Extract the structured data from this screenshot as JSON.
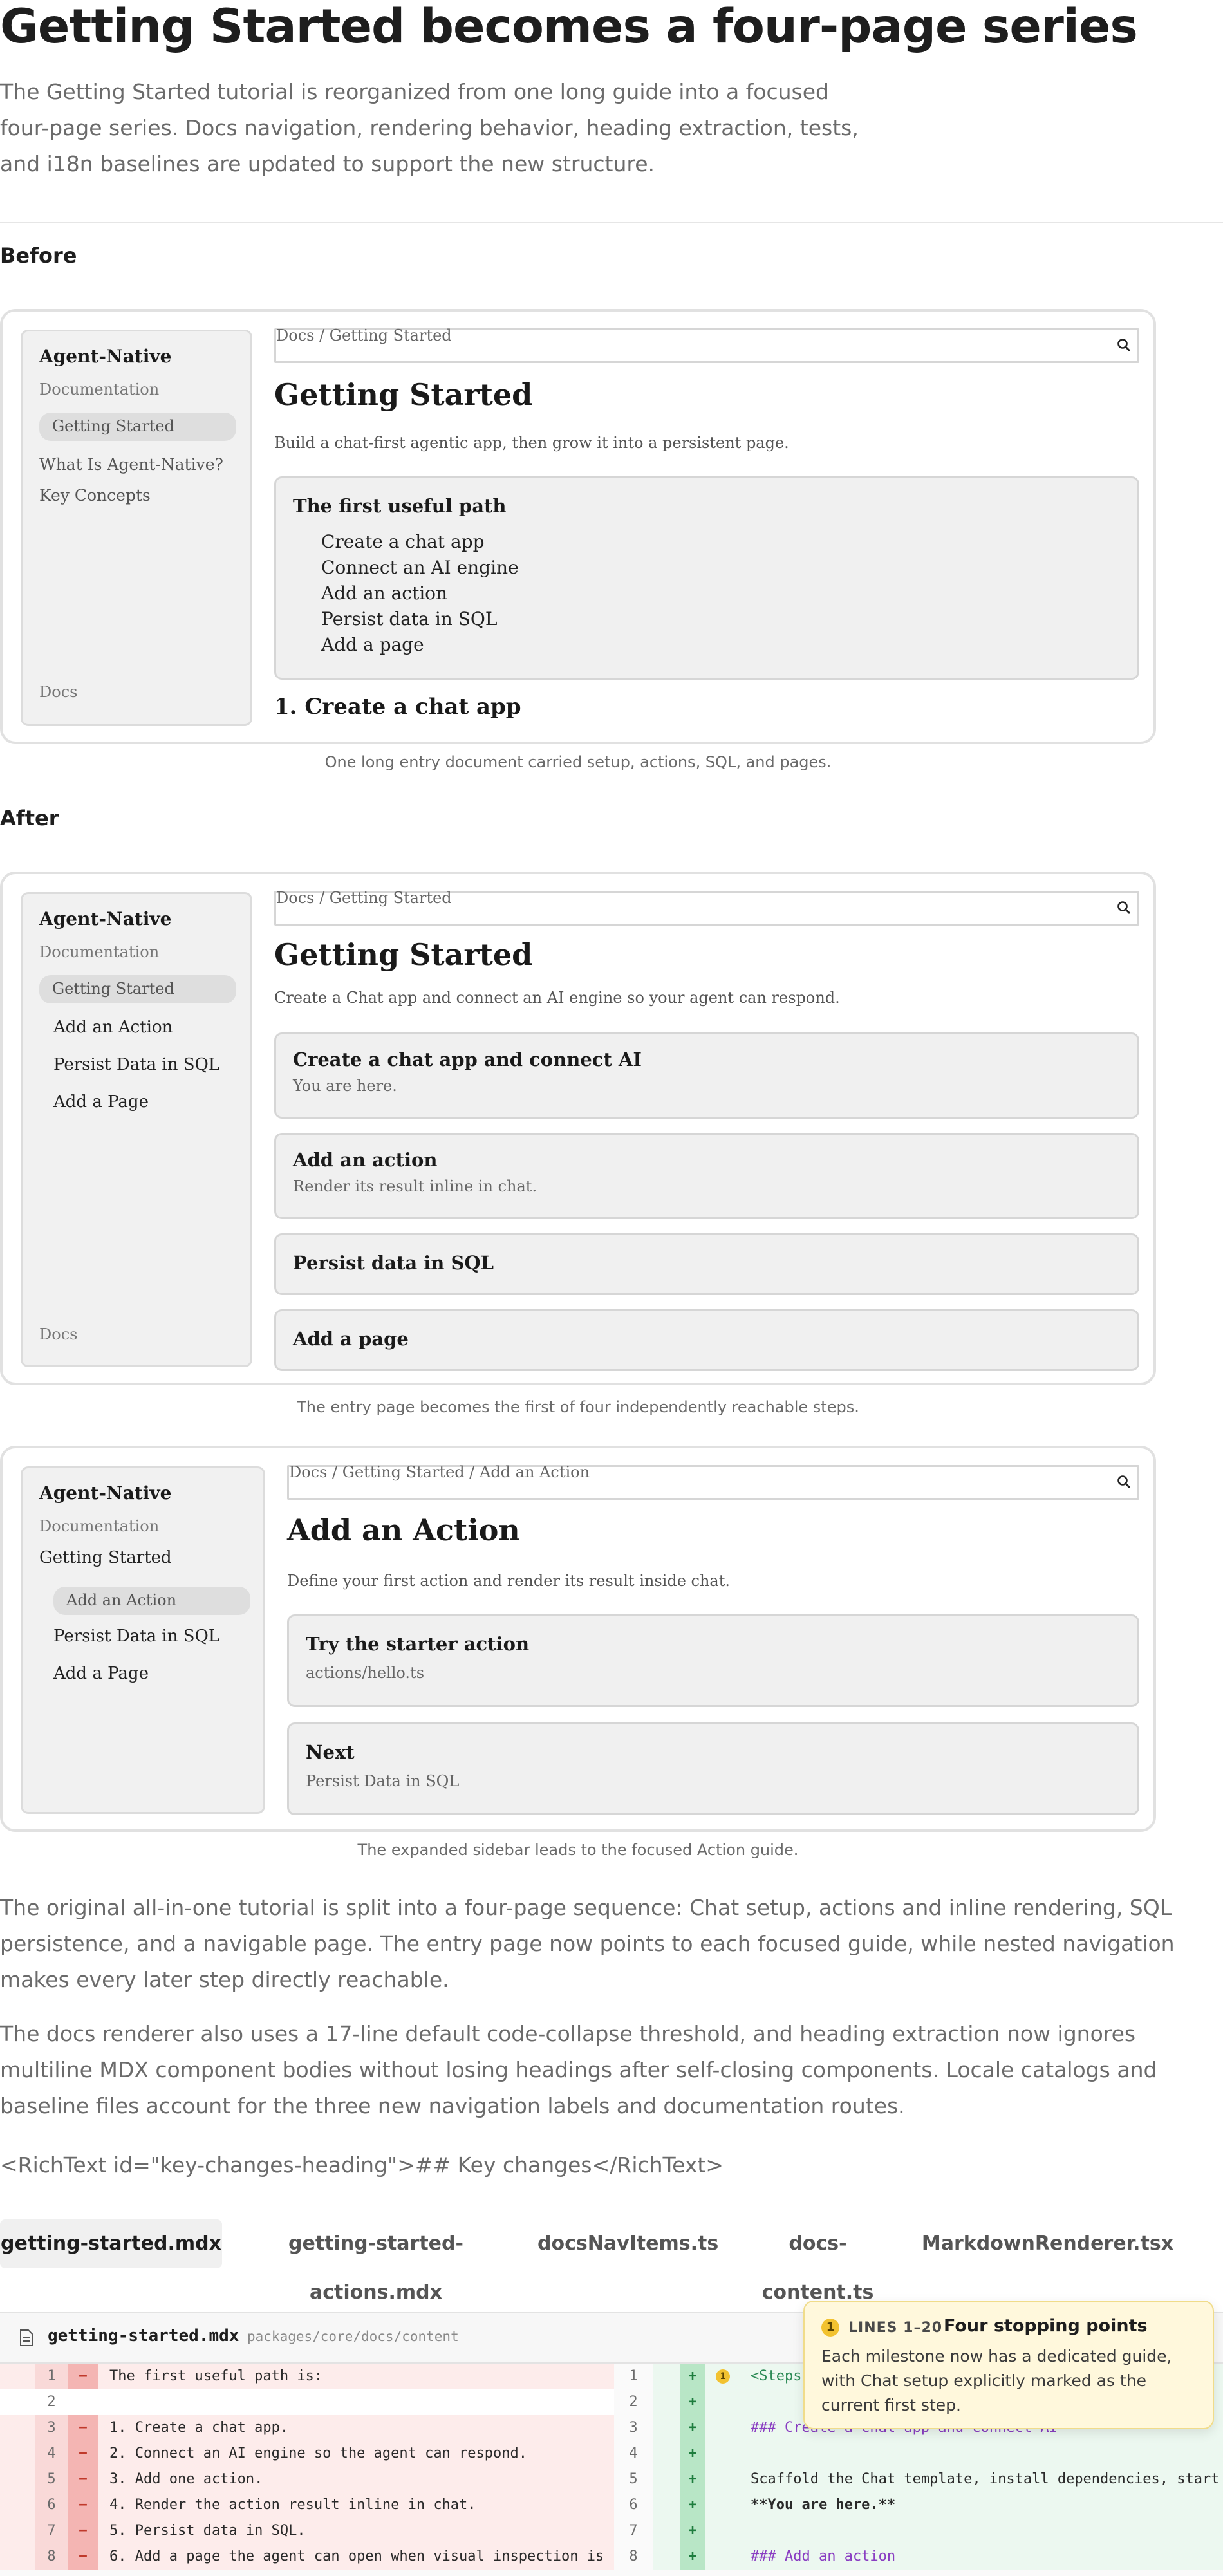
{
  "header": {
    "title": "Getting Started becomes a four-page series",
    "intro": "The Getting Started tutorial is reorganized from one long guide into a focused four-page series. Docs navigation, rendering behavior, heading extraction, tests, and i18n baselines are updated to support the new structure."
  },
  "before": {
    "heading": "Before",
    "sidebar": {
      "brand": "Agent-Native",
      "section": "Documentation",
      "active": "Getting Started",
      "items": [
        "What Is Agent-Native?",
        "Key Concepts"
      ],
      "footer": "Docs"
    },
    "breadcrumb": "Docs / Getting Started",
    "page_title": "Getting Started",
    "subtitle": "Build a chat-first agentic app, then grow it into a persistent page.",
    "path_card": {
      "title": "The first useful path",
      "items": [
        "Create a chat app",
        "Connect an AI engine",
        "Add an action",
        "Persist data in SQL",
        "Add a page"
      ]
    },
    "next_heading": "1. Create a chat app",
    "caption": "One long entry document carried setup, actions, SQL, and pages."
  },
  "after": {
    "heading": "After",
    "mock1": {
      "sidebar": {
        "brand": "Agent-Native",
        "section": "Documentation",
        "active": "Getting Started",
        "items": [
          "Add an Action",
          "Persist Data in SQL",
          "Add a Page"
        ],
        "footer": "Docs"
      },
      "breadcrumb": "Docs / Getting Started",
      "page_title": "Getting Started",
      "subtitle": "Create a Chat app and connect an AI engine so your agent can respond.",
      "cards": [
        {
          "title": "Create a chat app and connect AI",
          "sub": "You are here."
        },
        {
          "title": "Add an action",
          "sub": "Render its result inline in chat."
        },
        {
          "title": "Persist data in SQL",
          "sub": ""
        },
        {
          "title": "Add a page",
          "sub": ""
        }
      ],
      "caption": "The entry page becomes the first of four independently reachable steps."
    },
    "mock2": {
      "sidebar": {
        "brand": "Agent-Native",
        "section": "Documentation",
        "parent": "Getting Started",
        "active": "Add an Action",
        "items": [
          "Persist Data in SQL",
          "Add a Page"
        ]
      },
      "breadcrumb": "Docs / Getting Started / Add an Action",
      "page_title": "Add an Action",
      "subtitle": "Define your first action and render its result inside chat.",
      "cards": [
        {
          "title": "Try the starter action",
          "sub": "actions/hello.ts"
        },
        {
          "title": "Next",
          "sub": "Persist Data in SQL"
        }
      ],
      "caption": "The expanded sidebar leads to the focused Action guide."
    }
  },
  "body": {
    "p1": "The original all-in-one tutorial is split into a four-page sequence: Chat setup, actions and inline rendering, SQL persistence, and a navigable page. The entry page now points to each focused guide, while nested navigation makes every later step directly reachable.",
    "p2": "The docs renderer also uses a 17-line default code-collapse threshold, and heading extraction now ignores multiline MDX component bodies without losing headings after self-closing components. Locale catalogs and baseline files account for the three new navigation labels and documentation routes.",
    "richtext": "<RichText id=\"key-changes-heading\">## Key changes</RichText>"
  },
  "tabs": [
    "getting-started.mdx",
    "getting-started-actions.mdx",
    "docsNavItems.ts",
    "docs-content.ts",
    "MarkdownRenderer.tsx"
  ],
  "diff": {
    "filename": "getting-started.mdx",
    "path": "packages/core/docs/content",
    "left": [
      {
        "n": "1",
        "sign": "−",
        "text": "The first useful path is:",
        "type": "del"
      },
      {
        "n": "2",
        "sign": "",
        "text": "",
        "type": "ctx"
      },
      {
        "n": "3",
        "sign": "−",
        "text": "1. Create a chat app.",
        "type": "del"
      },
      {
        "n": "4",
        "sign": "−",
        "text": "2. Connect an AI engine so the agent can respond.",
        "type": "del"
      },
      {
        "n": "5",
        "sign": "−",
        "text": "3. Add one action.",
        "type": "del"
      },
      {
        "n": "6",
        "sign": "−",
        "text": "4. Render the action result inline in chat.",
        "type": "del"
      },
      {
        "n": "7",
        "sign": "−",
        "text": "5. Persist data in SQL.",
        "type": "del"
      },
      {
        "n": "8",
        "sign": "−",
        "text": "6. Add a page the agent can open when visual inspection is",
        "type": "del"
      }
    ],
    "right": [
      {
        "n": "1",
        "sign": "+",
        "text": "<Steps",
        "type": "add"
      },
      {
        "n": "2",
        "sign": "+",
        "text": "",
        "type": "add"
      },
      {
        "n": "3",
        "sign": "+",
        "text": "### Create a chat app and connect AI",
        "type": "add"
      },
      {
        "n": "4",
        "sign": "+",
        "text": "",
        "type": "add"
      },
      {
        "n": "5",
        "sign": "+",
        "text": "Scaffold the Chat template, install dependencies, start",
        "type": "add"
      },
      {
        "n": "6",
        "sign": "+",
        "text": "**You are here.**",
        "type": "add"
      },
      {
        "n": "7",
        "sign": "+",
        "text": "",
        "type": "add"
      },
      {
        "n": "8",
        "sign": "+",
        "text": "### Add an action",
        "type": "add"
      }
    ],
    "note": {
      "badge": "1",
      "lines": "LINES 1–20",
      "title": "Four stopping points",
      "body": "Each milestone now has a dedicated guide, with Chat setup explicitly marked as the current first step."
    }
  },
  "colors": {
    "added": "#1e7d3e",
    "removed": "#c0392b",
    "note": "#f2c230"
  }
}
